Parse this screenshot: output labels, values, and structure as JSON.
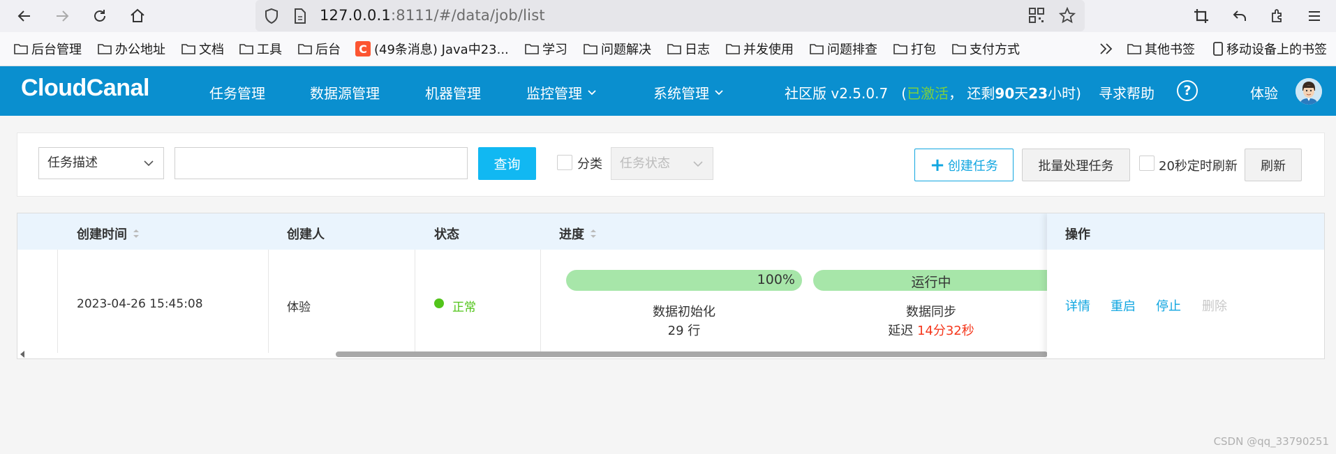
{
  "browser": {
    "url_host": "127.0.0.1",
    "url_rest": ":8111/#/data/job/list",
    "bookmarks": [
      {
        "label": "后台管理",
        "icon": "folder-icon"
      },
      {
        "label": "办公地址",
        "icon": "folder-icon"
      },
      {
        "label": "文档",
        "icon": "folder-icon"
      },
      {
        "label": "工具",
        "icon": "folder-icon"
      },
      {
        "label": "后台",
        "icon": "folder-icon"
      },
      {
        "label": "(49条消息) Java中23...",
        "icon": "csdn-icon",
        "badge": "C"
      },
      {
        "label": "学习",
        "icon": "folder-icon"
      },
      {
        "label": "问题解决",
        "icon": "folder-icon"
      },
      {
        "label": "日志",
        "icon": "folder-icon"
      },
      {
        "label": "并发使用",
        "icon": "folder-icon"
      },
      {
        "label": "问题排查",
        "icon": "folder-icon"
      },
      {
        "label": "打包",
        "icon": "folder-icon"
      },
      {
        "label": "支付方式",
        "icon": "folder-icon"
      }
    ],
    "other_bookmarks": "其他书签",
    "mobile_bookmarks": "移动设备上的书签"
  },
  "app": {
    "logo": "CloudCanal",
    "menu": [
      "任务管理",
      "数据源管理",
      "机器管理",
      "监控管理",
      "系统管理"
    ],
    "version": "社区版 v2.5.0.7",
    "status_open": "(",
    "status_activated": "已激活",
    "status_remaining_prefix": "， 还剩",
    "days": "90",
    "days_unit": "天",
    "hours": "23",
    "hours_unit": "小时)",
    "help": "寻求帮助",
    "help_icon": "?",
    "user": "体验",
    "accent_color": "#0a8fcf"
  },
  "filter": {
    "field_select": "任务描述",
    "search_value": "",
    "query_button": "查询",
    "category_label": "分类",
    "status_placeholder": "任务状态",
    "create_button": "创建任务",
    "batch_button": "批量处理任务",
    "auto_refresh_label": "20秒定时刷新",
    "refresh_button": "刷新"
  },
  "table": {
    "columns": {
      "created_time": "创建时间",
      "creator": "创建人",
      "status": "状态",
      "progress": "进度",
      "actions": "操作"
    },
    "rows": [
      {
        "created_time": "2023-04-26 15:45:08",
        "creator": "体验",
        "status": "正常",
        "status_color": "#52c41a",
        "init_percent": "100%",
        "init_fraction": 1.0,
        "init_label": "数据初始化",
        "init_rows": "29 行",
        "sync_status": "运行中",
        "sync_label": "数据同步",
        "delay_prefix": "延迟",
        "delay_value": "14分32秒",
        "actions": [
          "详情",
          "重启",
          "停止",
          "删除"
        ]
      }
    ]
  },
  "watermark": "CSDN @qq_33790251"
}
